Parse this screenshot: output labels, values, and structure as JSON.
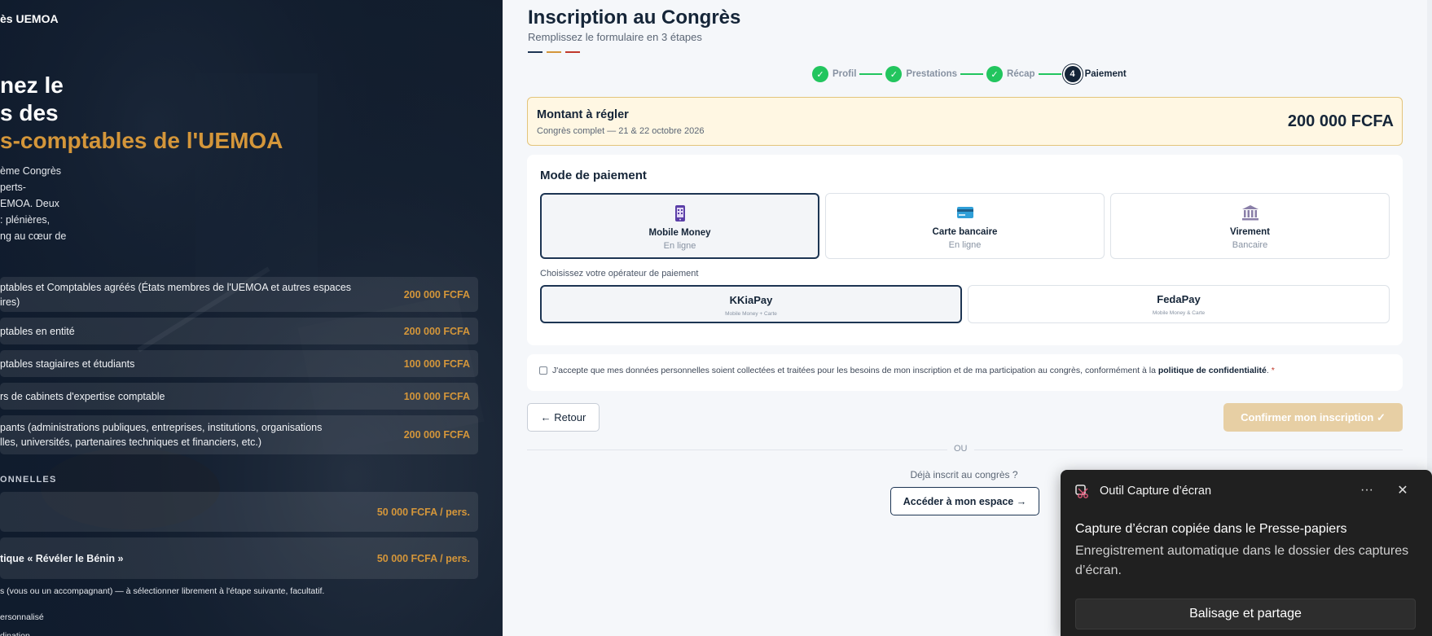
{
  "hero": {
    "brand": "ès UEMOA",
    "title_line1": "nez le",
    "title_line2": "s des",
    "title_accent": "s-comptables de l'UEMOA",
    "desc_lines": [
      "ème Congrès",
      "perts-",
      "EMOA. Deux",
      ": plénières,",
      "ng au cœur de"
    ],
    "tariffs": [
      {
        "label": "ptables et Comptables agréés (États membres de l'UEMOA et autres espaces\nires)",
        "price": "200 000 FCFA"
      },
      {
        "label": "ptables en entité",
        "price": "200 000 FCFA"
      },
      {
        "label": "ptables stagiaires et étudiants",
        "price": "100 000 FCFA"
      },
      {
        "label": "rs de cabinets d'expertise comptable",
        "price": "100 000 FCFA"
      },
      {
        "label": "pants (administrations publiques, entreprises, institutions, organisations\nlles, universités, partenaires techniques et financiers, etc.)",
        "price": "200 000 FCFA"
      }
    ],
    "section_label": "ONNELLES",
    "extras": [
      {
        "label": "",
        "price": "50 000 FCFA / pers."
      },
      {
        "label": "tique « Révéler le Bénin »",
        "price": "50 000 FCFA / pers."
      }
    ],
    "footnote": "s (vous ou un accompagnant) — à sélectionner librement à l'étape suivante, facultatif.",
    "footnote2": "ersonnalisé",
    "footnote3": "dination"
  },
  "form": {
    "title": "Inscription au Congrès",
    "subtitle": "Remplissez le formulaire en 3 étapes",
    "tricolor": [
      "#1d3553",
      "#d4963a",
      "#c0392b"
    ],
    "steps": [
      {
        "label": "Profil",
        "state": "done"
      },
      {
        "label": "Prestations",
        "state": "done"
      },
      {
        "label": "Récap",
        "state": "done"
      },
      {
        "number": "4",
        "label": "Paiement",
        "state": "active"
      }
    ],
    "amount": {
      "title": "Montant à régler",
      "subtitle": "Congrès complet — 21 & 22 octobre 2026",
      "value": "200 000 FCFA"
    },
    "payment": {
      "title": "Mode de paiement",
      "methods": [
        {
          "name": "Mobile Money",
          "sub": "En ligne",
          "icon": "mobile-phone-icon",
          "selected": true
        },
        {
          "name": "Carte bancaire",
          "sub": "En ligne",
          "icon": "credit-card-icon",
          "selected": false
        },
        {
          "name": "Virement",
          "sub": "Bancaire",
          "icon": "bank-icon",
          "selected": false
        }
      ],
      "operator_label": "Choisissez votre opérateur de paiement",
      "operators": [
        {
          "name": "KKiaPay",
          "sub": "Mobile Money + Carte",
          "selected": true
        },
        {
          "name": "FedaPay",
          "sub": "Mobile Money & Carte",
          "selected": false
        }
      ]
    },
    "consent": {
      "text": "J'accepte que mes données personnelles soient collectées et traitées pour les besoins de mon inscription et de ma participation au congrès, conformément à la ",
      "link": "politique de confidentialité",
      "end": ".",
      "required": "*"
    },
    "back_label": "← Retour",
    "confirm_label": "Confirmer mon inscription ✓",
    "or_label": "OU",
    "already_label": "Déjà inscrit au congrès ?",
    "space_label": "Accéder à mon espace →"
  },
  "toast": {
    "app": "Outil Capture d’écran",
    "more": "···",
    "close": "✕",
    "title": "Capture d’écran copiée dans le Presse-papiers",
    "body": "Enregistrement automatique dans le dossier des captures d’écran.",
    "button": "Balisage et partage"
  },
  "colors": {
    "accent_gold": "#d4963a",
    "navy": "#152538",
    "success_green": "#22c55e"
  }
}
